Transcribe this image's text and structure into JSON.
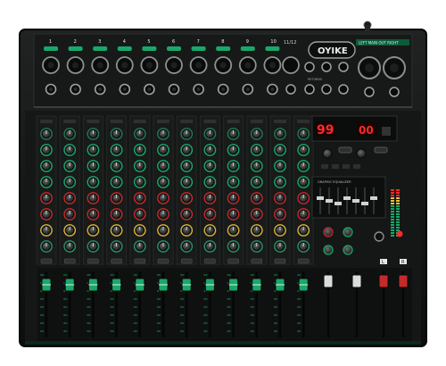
{
  "brand": {
    "logo_text": "OYIKE"
  },
  "top_panel": {
    "channel_numbers": [
      "1",
      "2",
      "3",
      "4",
      "5",
      "6",
      "7",
      "8",
      "9",
      "10"
    ],
    "stereo_label": "11/12",
    "main_out_label": "LEFT  MAIN OUT  RIGHT",
    "returns_label": "RETURNS"
  },
  "control_panel": {
    "display_left": "99",
    "display_right": "00",
    "eq_label": "GRAPHIC EQUALIZER"
  },
  "fader_bank": {
    "channel_count": 12,
    "master_labels": [
      "L",
      "R"
    ]
  },
  "colors": {
    "body": "#111312",
    "panel": "#1b1e1c",
    "accent_green": "#19a86a",
    "display_red": "#ff2a2a",
    "knob_red": "#c42a2a"
  }
}
